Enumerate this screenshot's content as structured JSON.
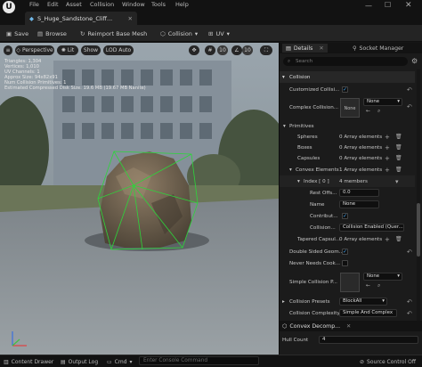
{
  "menu": {
    "items": [
      "File",
      "Edit",
      "Asset",
      "Collision",
      "Window",
      "Tools",
      "Help"
    ]
  },
  "tab": {
    "title": "S_Huge_Sandstone_Cliff..."
  },
  "toolbar": {
    "save": "Save",
    "browse": "Browse",
    "reimport": "Reimport Base Mesh",
    "collision": "Collision",
    "uv": "UV"
  },
  "viewport": {
    "perspective": "Perspective",
    "lit": "Lit",
    "show": "Show",
    "lod": "LOD Auto",
    "lod_num": "10",
    "num2": "10",
    "stats": [
      "Triangles: 1,304",
      "Vertices: 1,010",
      "UV Channels: 1",
      "Approx Size: 94x82x91",
      "Num Collision Primitives: 1",
      "Estimated Compressed Disk Size: 19.6 MB (19.67 MB Nanite)"
    ]
  },
  "details": {
    "tab1": "Details",
    "tab2": "Socket Manager",
    "search": "Search",
    "collision_header": "Collision",
    "customized": "Customized Collisi...",
    "complex": "Complex Collision...",
    "none1": "None",
    "none_sel": "None",
    "primitives": "Primitives",
    "spheres": "Spheres",
    "spheres_val": "0 Array elements",
    "boxes": "Boxes",
    "boxes_val": "0 Array elements",
    "capsules": "Capsules",
    "capsules_val": "0 Array elements",
    "convex": "Convex Elements",
    "convex_val": "1 Array elements",
    "index": "Index [ 0 ]",
    "index_val": "4 members",
    "rest_offset": "Rest Offs...",
    "rest_val": "0.0",
    "name": "Name",
    "name_val": "None",
    "contrib": "Contribut...",
    "collision": "Collision...",
    "collision_val": "Collision Enabled (Quer...",
    "tapered": "Tapered Capsul...",
    "tapered_val": "0 Array elements",
    "double_sided": "Double Sided Geom...",
    "never_needs": "Never Needs Cook...",
    "simple": "Simple Collision P...",
    "none2": "None",
    "presets": "Collision Presets",
    "presets_val": "BlockAll",
    "complexity": "Collision Complexity",
    "complexity_val": "Simple And Complex",
    "convex_decomp": "Convex Decomp...",
    "hull_count": "Hull Count",
    "hull_val": "4"
  },
  "bottom": {
    "content_drawer": "Content Drawer",
    "output_log": "Output Log",
    "cmd": "Cmd",
    "console": "Enter Console Command",
    "source_control": "Source Control Off"
  }
}
